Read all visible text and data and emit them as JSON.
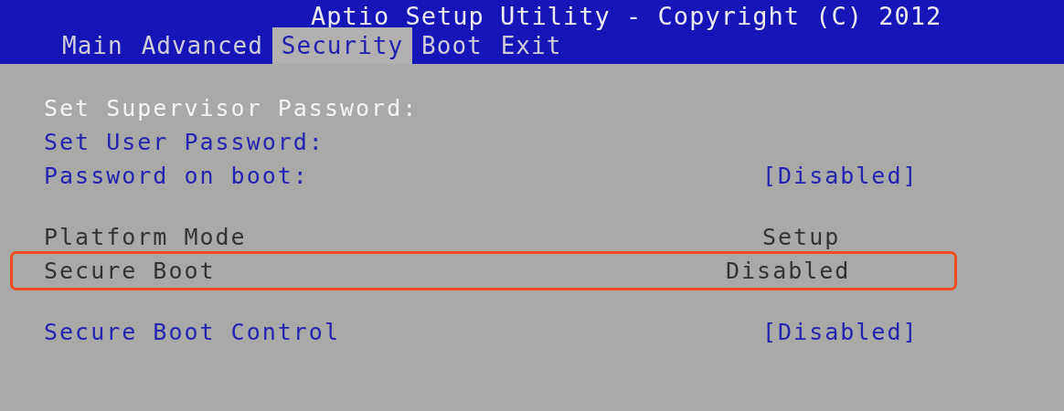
{
  "header": {
    "title": "Aptio Setup Utility - Copyright (C) 2012"
  },
  "tabs": [
    {
      "label": "Main",
      "selected": false
    },
    {
      "label": "Advanced",
      "selected": false
    },
    {
      "label": "Security",
      "selected": true
    },
    {
      "label": "Boot",
      "selected": false
    },
    {
      "label": "Exit",
      "selected": false
    }
  ],
  "groups": [
    {
      "items": [
        {
          "label": "Set Supervisor Password:",
          "kind": "option",
          "selected": true,
          "marked": false
        },
        {
          "label": "Set User Password:",
          "kind": "option",
          "selected": false,
          "marked": false
        },
        {
          "label": "Password on boot:",
          "kind": "option",
          "selected": false,
          "marked": false,
          "value": "[Disabled]"
        }
      ]
    },
    {
      "items": [
        {
          "label": "Platform Mode",
          "kind": "info",
          "selected": false,
          "marked": false,
          "value": "Setup"
        },
        {
          "label": "Secure Boot",
          "kind": "info",
          "selected": false,
          "marked": true,
          "value": "Disabled"
        }
      ]
    },
    {
      "items": [
        {
          "label": "Secure Boot Control",
          "kind": "option",
          "selected": false,
          "marked": false,
          "value": "[Disabled]"
        }
      ]
    }
  ]
}
